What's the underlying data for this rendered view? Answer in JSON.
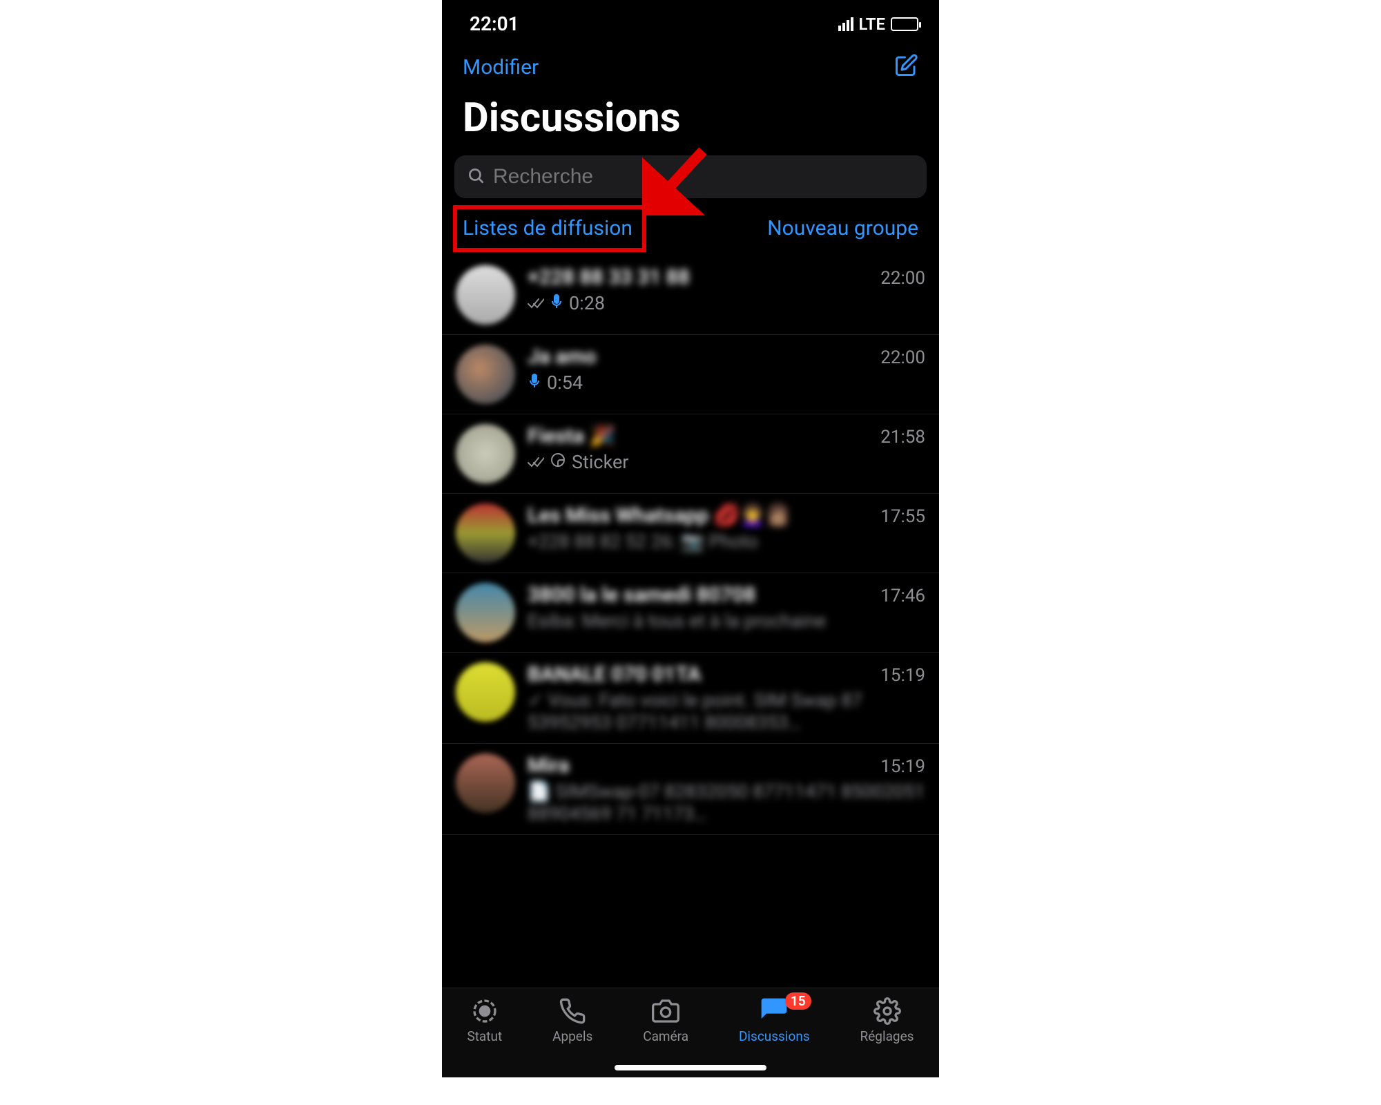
{
  "statusbar": {
    "time": "22:01",
    "network": "LTE"
  },
  "header": {
    "edit": "Modifier",
    "title": "Discussions"
  },
  "search": {
    "placeholder": "Recherche"
  },
  "sublinks": {
    "broadcast": "Listes de diffusion",
    "newgroup": "Nouveau groupe"
  },
  "chats": [
    {
      "name": "+228 88 33 31 88",
      "time": "22:00",
      "preview_type": "voice_read",
      "duration": "0:28"
    },
    {
      "name": "Ja amo",
      "time": "22:00",
      "preview_type": "voice",
      "duration": "0:54"
    },
    {
      "name": "Fiesta 🎉",
      "time": "21:58",
      "preview_type": "sticker",
      "sticker_label": "Sticker"
    },
    {
      "name": "Les Miss Whatsapp 💋👩‍🦱👩🏽",
      "time": "17:55",
      "preview_type": "text",
      "preview": "+228 88 82 52 26: 📷 Photo"
    },
    {
      "name": "3800 la le samedi 80708",
      "time": "17:46",
      "preview_type": "text",
      "preview": "Esiba: Merci à tous et à la prochaine"
    },
    {
      "name": "BANALE 070 01TA",
      "time": "15:19",
      "preview_type": "text",
      "preview": "✓ Vous: Fato voici le point. SIM Swap 87 53952953 07711411 80008353…"
    },
    {
      "name": "Mira",
      "time": "15:19",
      "preview_type": "text",
      "preview": "📄 SIMSwap-07 82832050 87711471 85002051 88904569 71 71173…"
    }
  ],
  "tabs": {
    "status": "Statut",
    "calls": "Appels",
    "camera": "Caméra",
    "chats": "Discussions",
    "settings": "Réglages",
    "badge": "15"
  }
}
